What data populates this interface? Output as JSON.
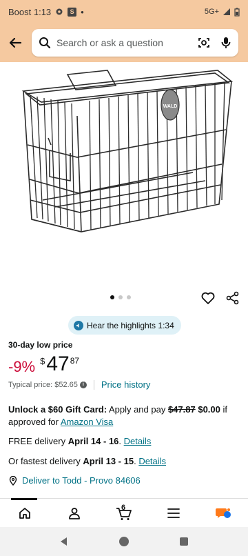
{
  "status_bar": {
    "carrier_time": "Boost 1:13",
    "app_badge": "S",
    "network": "5G+"
  },
  "search": {
    "placeholder": "Search or ask a question"
  },
  "carousel": {
    "image_badge": "WALD",
    "active_index": 1,
    "count": 3
  },
  "highlights": {
    "label": "Hear the highlights 1:34"
  },
  "pricing": {
    "low_price_label": "30-day low price",
    "discount": "-9%",
    "currency": "$",
    "whole": "47",
    "fraction": "87",
    "typical_label": "Typical price: $52.65",
    "history_link": "Price history"
  },
  "giftcard": {
    "bold": "Unlock a $60 Gift Card:",
    "text1": " Apply and pay ",
    "old_price": "$47.87",
    "new_price": "$0.00",
    "text2": " if approved for ",
    "link": "Amazon Visa"
  },
  "delivery": {
    "free_prefix": "FREE delivery ",
    "free_dates": "April 14 - 16",
    "free_link": "Details",
    "fast_prefix": "Or fastest delivery ",
    "fast_dates": "April 13 - 15",
    "fast_link": "Details",
    "deliver_to": "Deliver to Todd - Provo 84606"
  },
  "nav": {
    "cart_count": "6"
  },
  "colors": {
    "header_bg": "#f5c9a0",
    "link": "#007185",
    "discount": "#cc0c39"
  }
}
